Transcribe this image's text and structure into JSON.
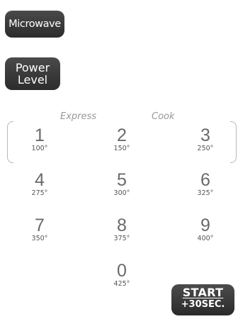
{
  "buttons": {
    "microwave": "Microwave",
    "power_level": [
      "Power",
      "Level"
    ],
    "start": [
      "START",
      "+30SEC."
    ]
  },
  "labels": {
    "express": "Express",
    "cook": "Cook"
  },
  "keys": [
    {
      "digit": "1",
      "temp": "100°"
    },
    {
      "digit": "2",
      "temp": "150°"
    },
    {
      "digit": "3",
      "temp": "250°"
    },
    {
      "digit": "4",
      "temp": "275°"
    },
    {
      "digit": "5",
      "temp": "300°"
    },
    {
      "digit": "6",
      "temp": "325°"
    },
    {
      "digit": "7",
      "temp": "350°"
    },
    {
      "digit": "8",
      "temp": "375°"
    },
    {
      "digit": "9",
      "temp": "400°"
    },
    {
      "digit": "0",
      "temp": "425°"
    }
  ],
  "colors": {
    "button_bg": "#3a3a3a",
    "key_text": "#666666",
    "label_text": "#999999"
  }
}
